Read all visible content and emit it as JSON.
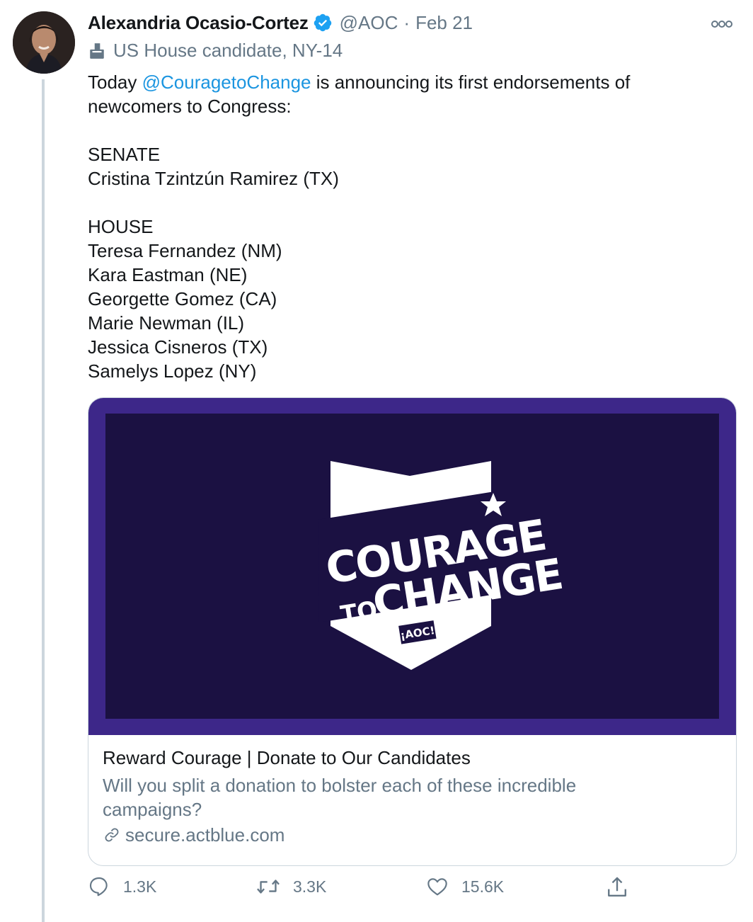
{
  "tweet": {
    "author_name": "Alexandria Ocasio-Cortez",
    "handle": "@AOC",
    "separator": "·",
    "date": "Feb 21",
    "label": "US House candidate, NY-14",
    "text_before_mention": "Today ",
    "mention": "@CouragetoChange",
    "text_after_mention": " is announcing its first endorsements of",
    "lines": [
      "newcomers to Congress:",
      "",
      "SENATE",
      "Cristina Tzintzún Ramirez (TX)",
      "",
      "HOUSE",
      "Teresa Fernandez (NM)",
      "Kara Eastman (NE)",
      "Georgette Gomez (CA)",
      "Marie Newman (IL)",
      "Jessica Cisneros (TX)",
      "Samelys Lopez (NY)"
    ]
  },
  "card": {
    "logo": {
      "line1": "COURAGE",
      "line2a": "TO",
      "line2b": "CHANGE",
      "badge": "¡AOC!"
    },
    "title": "Reward Courage | Donate to Our Candidates",
    "description": "Will you split a donation to bolster each of these incredible campaigns?",
    "url": "secure.actblue.com"
  },
  "actions": {
    "reply_count": "1.3K",
    "retweet_count": "3.3K",
    "like_count": "15.6K"
  },
  "icons": [
    "verified-badge-icon",
    "ballot-box-icon",
    "more-icon",
    "link-icon",
    "reply-icon",
    "retweet-icon",
    "like-icon",
    "share-icon"
  ],
  "colors": {
    "verified": "#1da1f2",
    "mention": "#1b95e0",
    "secondary_text": "#657786",
    "card_frame": "#3d2789",
    "card_image_bg": "#1b1142"
  }
}
